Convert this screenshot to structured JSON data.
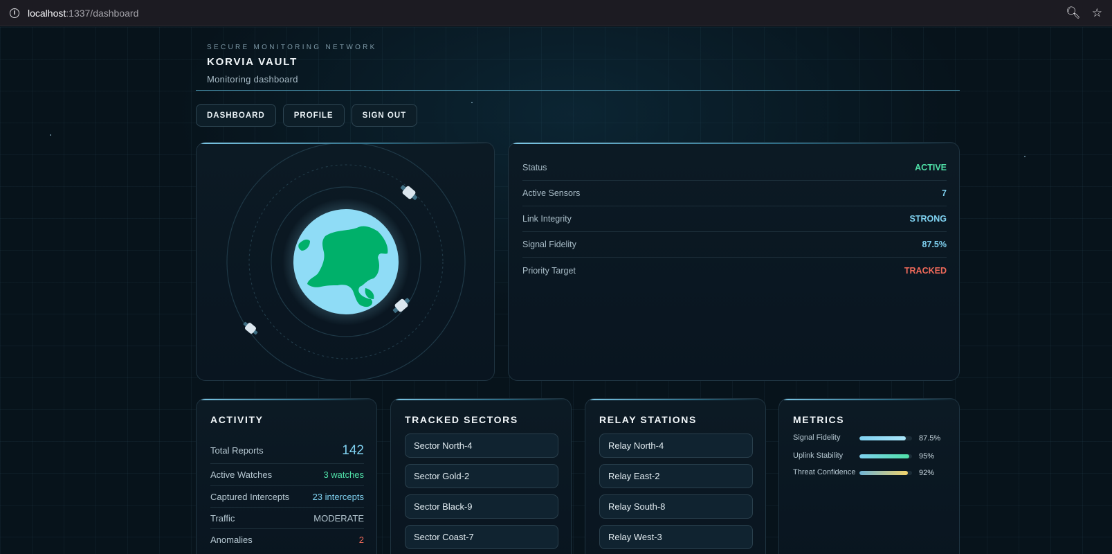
{
  "browser": {
    "url_host": "localhost",
    "url_rest": ":1337/dashboard"
  },
  "header": {
    "eyebrow": "SECURE MONITORING NETWORK",
    "brand": "KORVIA VAULT",
    "subtitle": "Monitoring dashboard"
  },
  "nav": {
    "dashboard": "DASHBOARD",
    "profile": "PROFILE",
    "sign_out": "SIGN OUT"
  },
  "status": {
    "rows": [
      {
        "label": "Status",
        "value": "ACTIVE",
        "color": "#4fe0a7"
      },
      {
        "label": "Active Sensors",
        "value": "7",
        "color": "#7fd1f0"
      },
      {
        "label": "Link Integrity",
        "value": "STRONG",
        "color": "#7fd1f0"
      },
      {
        "label": "Signal Fidelity",
        "value": "87.5%",
        "color": "#7fd1f0"
      },
      {
        "label": "Priority Target",
        "value": "TRACKED",
        "color": "#f06a5a"
      }
    ]
  },
  "activity": {
    "title": "ACTIVITY",
    "rows": [
      {
        "label": "Total Reports",
        "value": "142",
        "color": "#7fd1f0"
      },
      {
        "label": "Active Watches",
        "value": "3 watches",
        "color": "#4fe0a7"
      },
      {
        "label": "Captured Intercepts",
        "value": "23 intercepts",
        "color": "#7fd1f0"
      },
      {
        "label": "Traffic",
        "value": "MODERATE",
        "color": "#b6c8d2"
      },
      {
        "label": "Anomalies",
        "value": "2",
        "color": "#f06a5a"
      }
    ]
  },
  "sectors": {
    "title": "TRACKED SECTORS",
    "items": [
      "Sector North-4",
      "Sector Gold-2",
      "Sector Black-9",
      "Sector Coast-7"
    ]
  },
  "relays": {
    "title": "RELAY STATIONS",
    "items": [
      "Relay North-4",
      "Relay East-2",
      "Relay South-8",
      "Relay West-3"
    ]
  },
  "metrics": {
    "title": "METRICS",
    "rows": [
      {
        "label": "Signal Fidelity",
        "value": "87.5%",
        "fraction": 0.875
      },
      {
        "label": "Uplink Stability",
        "value": "95%",
        "fraction": 0.95
      },
      {
        "label": "Threat Confidence",
        "value": "92%",
        "fraction": 0.92
      }
    ]
  },
  "colors": {
    "accent": "#7fd1f0",
    "good": "#4fe0a7",
    "alert": "#f06a5a",
    "earth_ocean": "#8fdcf6",
    "earth_land": "#00b06a"
  },
  "icons": [
    "info-icon",
    "zoom-icon",
    "bookmark-star-icon",
    "earth-icon",
    "satellite-icon"
  ]
}
